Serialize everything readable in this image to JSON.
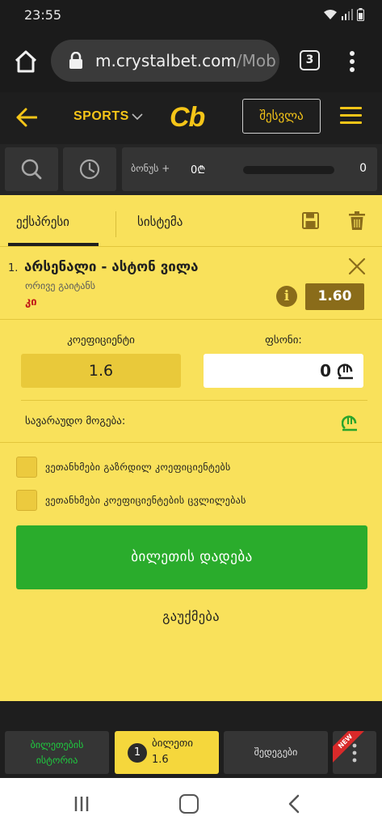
{
  "status_bar": {
    "time": "23:55"
  },
  "browser": {
    "url_domain": "m.crystalbet.com",
    "url_path": "/Mob",
    "tab_count": "3"
  },
  "header": {
    "sports_label": "SPORTS",
    "logo_text": "Cb",
    "login_label": "შესვლა"
  },
  "bonus": {
    "label": "ბონუს +",
    "amount": "0₾",
    "count": "0"
  },
  "betslip": {
    "tabs": [
      {
        "label": "ექსპრესი",
        "active": true
      },
      {
        "label": "სისტემა",
        "active": false
      }
    ],
    "bets": [
      {
        "index": "1.",
        "event": "არსენალი - ასტონ ვილა",
        "market": "ორივე გაიტანს",
        "selection": "კი",
        "odd": "1.60"
      }
    ],
    "coefficient_label": "კოეფიციენტი",
    "coefficient_value": "1.6",
    "stake_label": "ფსონი:",
    "stake_value": "0",
    "possible_win_label": "სავარაუდო მოგება:",
    "options": [
      {
        "label": "ვეთანხმები გაზრდილ კოეფიციენტებს",
        "checked": false
      },
      {
        "label": "ვეთანხმები კოეფიციენტების ცვლილებას",
        "checked": false
      }
    ],
    "place_bet_label": "ბილეთის დადება",
    "cancel_label": "გაუქმება"
  },
  "bottom_tabs": {
    "history_line1": "ბილეთების",
    "history_line2": "ისტორია",
    "slip_badge": "1",
    "slip_title": "ბილეთი",
    "slip_value": "1.6",
    "results_label": "შედეგები",
    "new_badge": "NEW"
  },
  "colors": {
    "brand_yellow": "#f5c518",
    "panel_yellow": "#f9e15b",
    "odd_brown": "#8a6c1a",
    "success_green": "#2aac2c",
    "selection_red": "#c01818"
  },
  "icons": [
    "home-icon",
    "lock-icon",
    "menu-dots-icon",
    "back-arrow-icon",
    "chevron-down-icon",
    "hamburger-icon",
    "search-icon",
    "clock-icon",
    "save-icon",
    "trash-icon",
    "close-icon",
    "info-icon",
    "lari-icon",
    "recents-icon",
    "back-icon"
  ]
}
